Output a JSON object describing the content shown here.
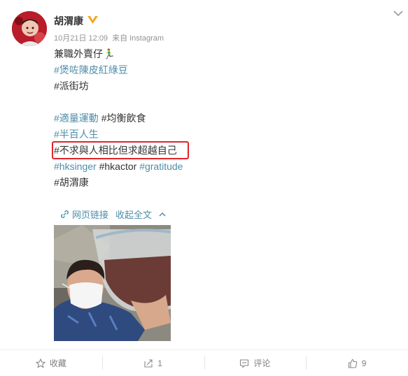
{
  "post": {
    "username": "胡渭康",
    "date": "10月21日 12:09",
    "source_prefix": "来自",
    "source": "Instagram",
    "lines": {
      "l1": "兼職外賣仔🏃‍♂️",
      "l2": "#煲咗陳皮紅綠豆",
      "l3": "#派街坊",
      "l5a": "#適量運動",
      "l5b": "#均衡飲食",
      "l6": "#半百人生",
      "l7": "#不求與人相比但求超越自己",
      "l8a": "#hksinger",
      "l8b": "#hkactor",
      "l8c": "#gratitude",
      "l9": "#胡渭康"
    },
    "links": {
      "web_link": "网页链接",
      "collapse": "收起全文"
    }
  },
  "actions": {
    "favorite": "收藏",
    "share_count": "1",
    "comment": "评论",
    "like_count": "9"
  },
  "colors": {
    "link": "#4e8daa",
    "highlight_box": "#e0242b",
    "verified": "#f5a623"
  }
}
